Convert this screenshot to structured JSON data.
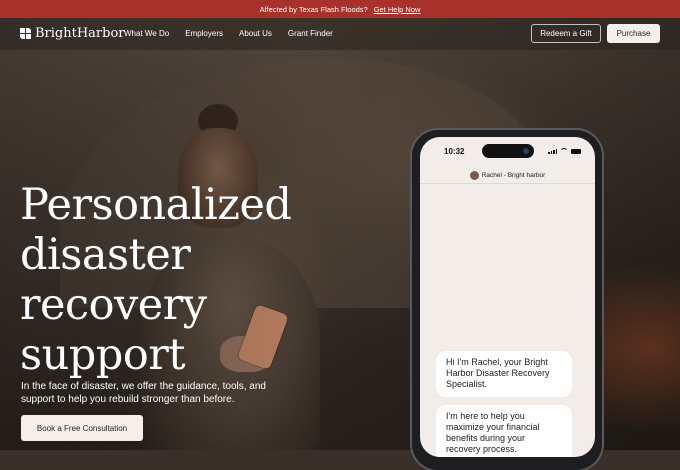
{
  "banner": {
    "message": "Affected by Texas Flash Floods?",
    "link": "Get Help Now"
  },
  "header": {
    "logo": "BrightHarbor",
    "nav": [
      "What We Do",
      "Employers",
      "About Us",
      "Grant Finder"
    ],
    "gift_button": "Redeem a Gift",
    "purchase_button": "Purchase"
  },
  "hero": {
    "headline_lines": [
      "Personalized",
      "disaster",
      "recovery",
      "support"
    ],
    "subtext": "In the face of disaster, we offer the guidance, tools, and support to help you rebuild stronger than before.",
    "cta": "Book a Free Consultation"
  },
  "phone": {
    "time": "10:32",
    "chat_name": "Rachel -  Bright harbor",
    "messages": [
      "Hi I'm Rachel, your Bright Harbor Disaster Recovery Specialist.",
      "I'm here to help you maximize your  financial benefits during your recovery process."
    ]
  },
  "colors": {
    "banner": "#a8322b",
    "button_light": "#f4efea",
    "screen_bg": "#f2ede8"
  }
}
